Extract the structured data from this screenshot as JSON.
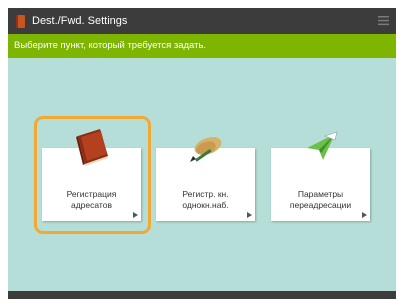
{
  "header": {
    "title": "Dest./Fwd. Settings",
    "app_icon": "book-icon",
    "menu_icon": "menu-icon"
  },
  "instruction": "Выберите пункт, который требуется задать.",
  "tiles": [
    {
      "line1": "Регистрация",
      "line2": "адресатов",
      "icon": "address-book-icon",
      "focused": true
    },
    {
      "line1": "Регистр. кн.",
      "line2": "однокн.наб.",
      "icon": "one-touch-pen-icon",
      "focused": false
    },
    {
      "line1": "Параметры",
      "line2": "переадресации",
      "icon": "forward-paper-plane-icon",
      "focused": false
    }
  ],
  "colors": {
    "titlebar": "#3c3c3c",
    "instruction_bar": "#7eb500",
    "background": "#b5ded8",
    "focus": "#f3a833"
  }
}
